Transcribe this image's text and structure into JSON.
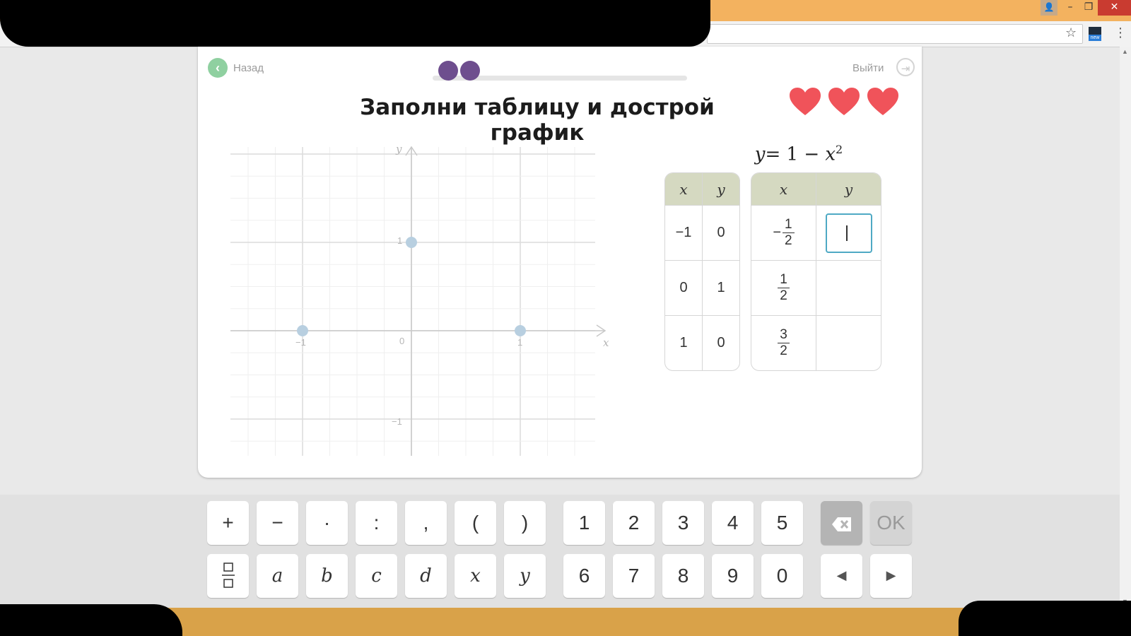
{
  "window": {
    "controls": {
      "user": "👤",
      "minimize": "–",
      "maximize": "❐",
      "close": "✕"
    },
    "extension_badge": "new"
  },
  "nav": {
    "back_label": "Назад",
    "exit_label": "Выйти"
  },
  "progress": {
    "filled_dots": 2
  },
  "task": {
    "title": "Заполни таблицу и дострой график",
    "lives": 3
  },
  "graph": {
    "axis_x_label": "x",
    "axis_y_label": "y",
    "origin_label": "0",
    "x_ticks": [
      "−1",
      "1"
    ],
    "y_ticks": [
      "1",
      "−1"
    ],
    "points": [
      {
        "x": -1,
        "y": 0
      },
      {
        "x": 0,
        "y": 1
      },
      {
        "x": 1,
        "y": 0
      }
    ]
  },
  "formula": {
    "lhs": "y",
    "rhs": "= 1 − ",
    "var": "x",
    "exp": "2"
  },
  "table1": {
    "headers": [
      "x",
      "y"
    ],
    "rows": [
      [
        "−1",
        "0"
      ],
      [
        "0",
        "1"
      ],
      [
        "1",
        "0"
      ]
    ]
  },
  "table2": {
    "headers": [
      "x",
      "y"
    ],
    "rows": [
      {
        "sign": "−",
        "num": "1",
        "den": "2",
        "y": ""
      },
      {
        "sign": "",
        "num": "1",
        "den": "2",
        "y": ""
      },
      {
        "sign": "",
        "num": "3",
        "den": "2",
        "y": ""
      }
    ]
  },
  "keyboard": {
    "row1_symbols": [
      "+",
      "−",
      "·",
      ":",
      ",",
      "(",
      ")"
    ],
    "row1_digits": [
      "1",
      "2",
      "3",
      "4",
      "5"
    ],
    "row2_vars": [
      "a",
      "b",
      "c",
      "d",
      "x",
      "y"
    ],
    "row2_digits": [
      "6",
      "7",
      "8",
      "9",
      "0"
    ],
    "ok_label": "OK",
    "left_arrow": "◀",
    "right_arrow": "▶"
  },
  "colors": {
    "accent_purple": "#6e4e8e",
    "back_green": "#8fd0a0",
    "heart_red": "#f0535a",
    "input_border": "#4ea9c4",
    "table_header": "#d5d9c1",
    "point_blue": "#b8cfe0"
  }
}
